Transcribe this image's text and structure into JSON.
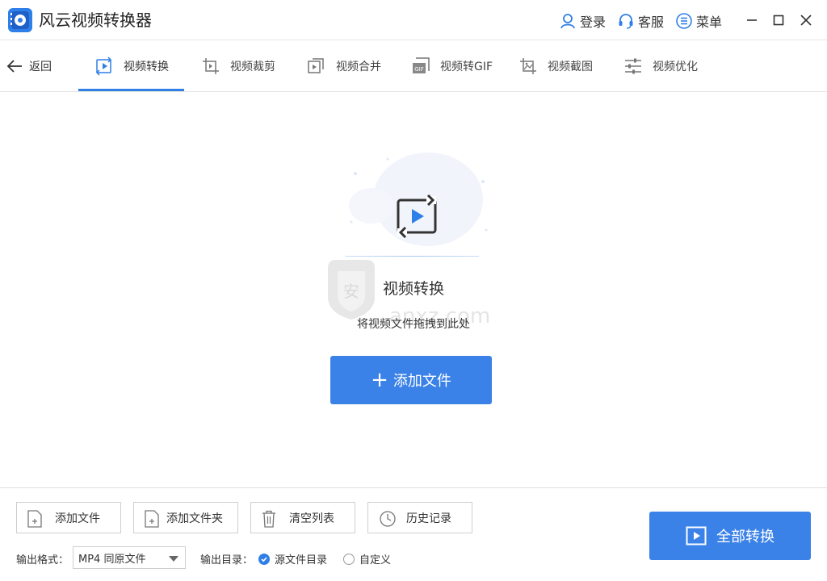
{
  "app": {
    "title": "风云视频转换器"
  },
  "titlebar": {
    "login_label": "登录",
    "support_label": "客服",
    "menu_label": "菜单"
  },
  "nav": {
    "back_label": "返回",
    "tabs": [
      {
        "label": "视频转换",
        "icon": "video-convert-icon",
        "active": true
      },
      {
        "label": "视频裁剪",
        "icon": "video-crop-icon",
        "active": false
      },
      {
        "label": "视频合并",
        "icon": "video-merge-icon",
        "active": false
      },
      {
        "label": "视频转GIF",
        "icon": "video-gif-icon",
        "active": false
      },
      {
        "label": "视频截图",
        "icon": "video-screenshot-icon",
        "active": false
      },
      {
        "label": "视频优化",
        "icon": "video-optimize-icon",
        "active": false
      }
    ]
  },
  "main": {
    "title": "视频转换",
    "subtitle": "将视频文件拖拽到此处",
    "add_file_label": "添加文件",
    "watermark_text": "anxz.com"
  },
  "bottom": {
    "buttons": [
      {
        "label": "添加文件",
        "icon": "add-file-icon"
      },
      {
        "label": "添加文件夹",
        "icon": "add-folder-icon"
      },
      {
        "label": "清空列表",
        "icon": "trash-icon"
      },
      {
        "label": "历史记录",
        "icon": "clock-icon"
      }
    ],
    "format_label": "输出格式：",
    "format_value": "MP4 同原文件",
    "output_dir_label": "输出目录：",
    "dir_options": [
      {
        "label": "源文件目录",
        "selected": true
      },
      {
        "label": "自定义",
        "selected": false
      }
    ],
    "convert_all_label": "全部转换"
  },
  "colors": {
    "accent": "#3b82e8",
    "active_tab_indicator": "#2f7fe8"
  }
}
